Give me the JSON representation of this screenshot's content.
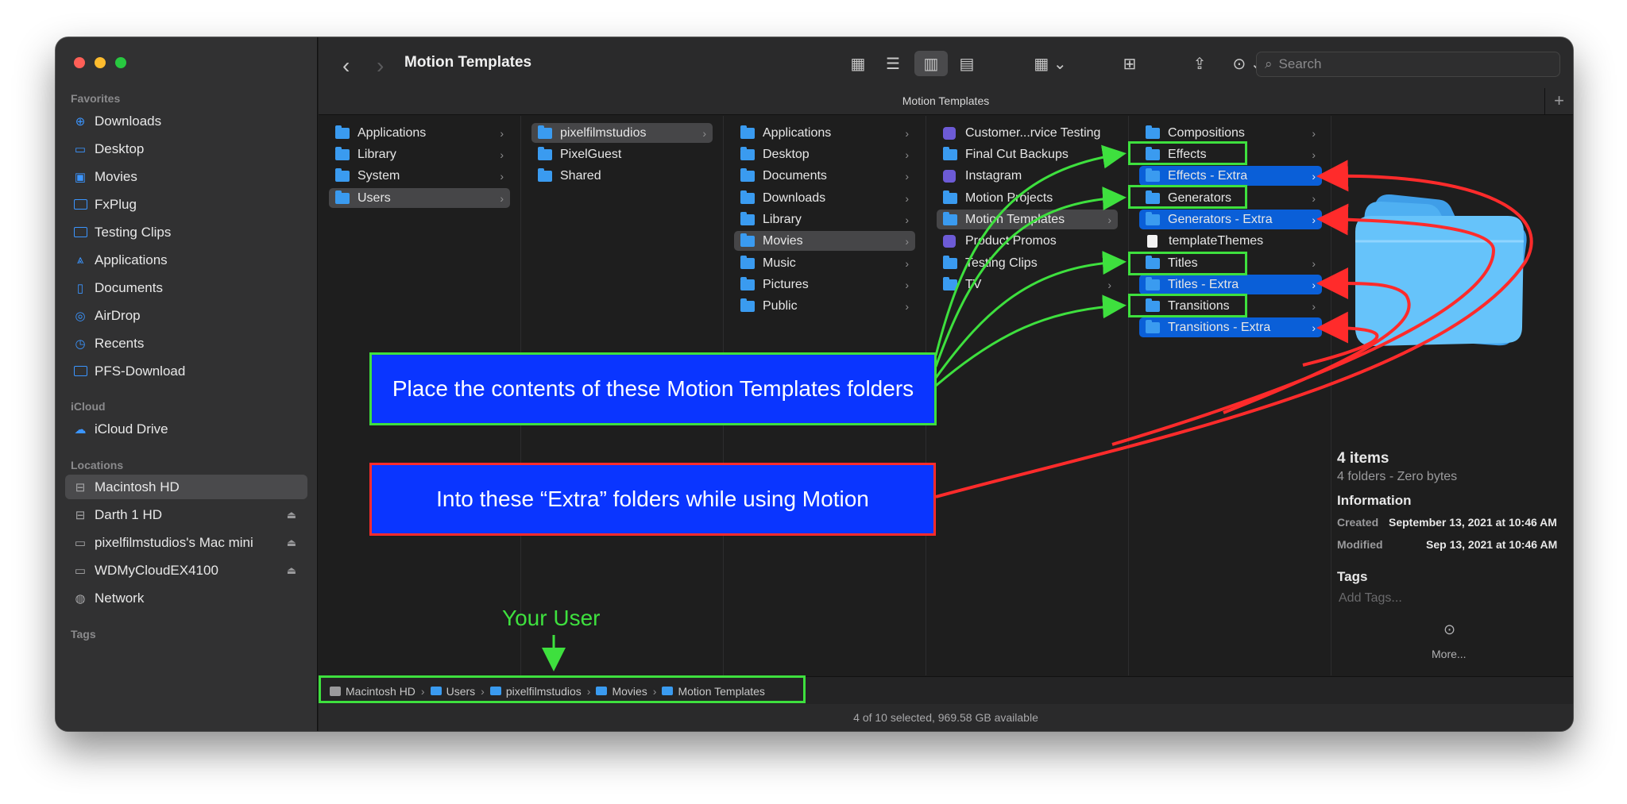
{
  "window": {
    "title": "Motion Templates",
    "path_title": "Motion Templates"
  },
  "sidebar": {
    "favorites_label": "Favorites",
    "favorites": [
      {
        "label": "Downloads",
        "icon": "download-circle-icon"
      },
      {
        "label": "Desktop",
        "icon": "desktop-icon"
      },
      {
        "label": "Movies",
        "icon": "film-icon"
      },
      {
        "label": "FxPlug",
        "icon": "folder-icon"
      },
      {
        "label": "Testing Clips",
        "icon": "folder-icon"
      },
      {
        "label": "Applications",
        "icon": "applications-icon"
      },
      {
        "label": "Documents",
        "icon": "document-icon"
      },
      {
        "label": "AirDrop",
        "icon": "airdrop-icon"
      },
      {
        "label": "Recents",
        "icon": "clock-icon"
      },
      {
        "label": "PFS-Download",
        "icon": "folder-icon"
      }
    ],
    "icloud_label": "iCloud",
    "icloud": [
      {
        "label": "iCloud Drive",
        "icon": "cloud-icon"
      }
    ],
    "locations_label": "Locations",
    "locations": [
      {
        "label": "Macintosh HD",
        "icon": "hard-drive-icon"
      },
      {
        "label": "Darth 1 HD",
        "icon": "hard-drive-icon"
      },
      {
        "label": "pixelfilmstudios's Mac mini",
        "icon": "mac-mini-icon"
      },
      {
        "label": "WDMyCloudEX4100",
        "icon": "display-icon"
      },
      {
        "label": "Network",
        "icon": "globe-icon"
      }
    ],
    "tags_label": "Tags"
  },
  "toolbar": {
    "search_placeholder": "Search"
  },
  "columns": {
    "col1": [
      "Applications",
      "Library",
      "System",
      "Users"
    ],
    "col2": [
      "pixelfilmstudios",
      "PixelGuest",
      "Shared"
    ],
    "col3": [
      "Applications",
      "Desktop",
      "Documents",
      "Downloads",
      "Library",
      "Movies",
      "Music",
      "Pictures",
      "Public"
    ],
    "col4": [
      "Customer...rvice Testing",
      "Final Cut Backups",
      "Instagram",
      "Motion Projects",
      "Motion Templates",
      "Product Promos",
      "Testing Clips",
      "TV"
    ],
    "col5": [
      "Compositions",
      "Effects",
      "Effects - Extra",
      "Generators",
      "Generators - Extra",
      "templateThemes",
      "Titles",
      "Titles - Extra",
      "Transitions",
      "Transitions - Extra"
    ]
  },
  "preview": {
    "count": "4 items",
    "summary": "4 folders - Zero bytes",
    "information_label": "Information",
    "created_label": "Created",
    "created_value": "September 13, 2021 at 10:46 AM",
    "modified_label": "Modified",
    "modified_value": "Sep 13, 2021 at 10:46 AM",
    "tags_label": "Tags",
    "tags_placeholder": "Add Tags...",
    "more_label": "More..."
  },
  "pathbar": [
    "Macintosh HD",
    "Users",
    "pixelfilmstudios",
    "Movies",
    "Motion Templates"
  ],
  "status": "4 of 10 selected, 969.58 GB available",
  "annotations": {
    "green_callout": "Place the contents of these Motion Templates folders",
    "red_callout": "Into these “Extra” folders while using Motion",
    "your_user": "Your User",
    "green_color": "#3ee03e",
    "red_color": "#ff2b2b",
    "callout_bg": "#0a35ff"
  },
  "colors": {
    "selection_blue": "#0a5fd8",
    "folder_blue": "#3a9bf0",
    "window_bg": "#1e1e1e"
  }
}
